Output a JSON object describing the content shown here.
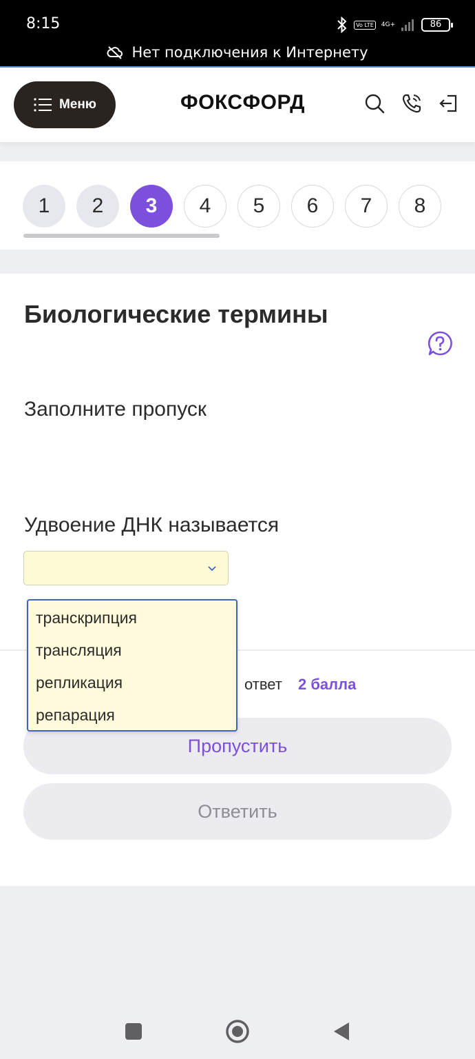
{
  "status_bar": {
    "time": "8:15",
    "volte": "Vo LTE",
    "network": "4G+",
    "battery": "86",
    "offline_message": "Нет подключения к Интернету"
  },
  "header": {
    "menu_label": "Меню",
    "logo_text": "ФОКСФОРД",
    "icons": [
      "search-icon",
      "phone-icon",
      "login-icon"
    ]
  },
  "stepper": {
    "steps": [
      "1",
      "2",
      "3",
      "4",
      "5",
      "6",
      "7",
      "8"
    ],
    "current": 3,
    "progress_fraction": 0.375
  },
  "task": {
    "title": "Биологические термины",
    "instruction": "Заполните пропуск",
    "question": "Удвоение ДНК называется",
    "select_value": "",
    "options": [
      "транскрипция",
      "трансляция",
      "репликация",
      "репарация"
    ],
    "score_label": "ответ",
    "score_points": "2 балла",
    "skip_label": "Пропустить",
    "answer_label": "Ответить"
  },
  "colors": {
    "accent": "#7c4fdd",
    "menu_bg": "#2a2420",
    "select_bg": "#fffbd7",
    "dropdown_border": "#3f64b8"
  }
}
